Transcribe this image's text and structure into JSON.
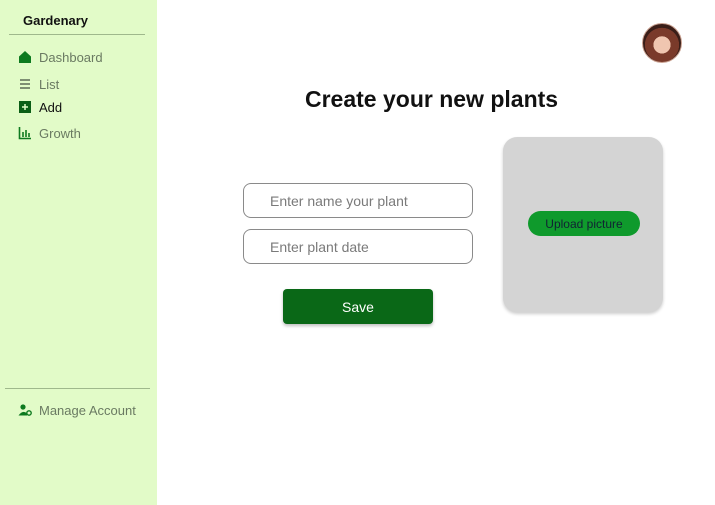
{
  "app": {
    "brand": "Gardenary"
  },
  "sidebar": {
    "items": [
      {
        "label": "Dashboard",
        "icon": "home-icon"
      },
      {
        "label": "List",
        "icon": "list-icon"
      },
      {
        "label": "Add",
        "icon": "add-icon"
      },
      {
        "label": "Growth",
        "icon": "chart-icon"
      }
    ],
    "active": "Add",
    "manage_label": "Manage Account"
  },
  "main": {
    "title": "Create your new plants",
    "name_placeholder": "Enter name your plant",
    "date_placeholder": "Enter plant date",
    "save_label": "Save",
    "upload_label": "Upload picture"
  },
  "colors": {
    "sidebar_bg": "#e2fbc8",
    "primary_green": "#0a6817",
    "upload_green": "#0f9a2c",
    "card_gray": "#d4d4d4"
  }
}
